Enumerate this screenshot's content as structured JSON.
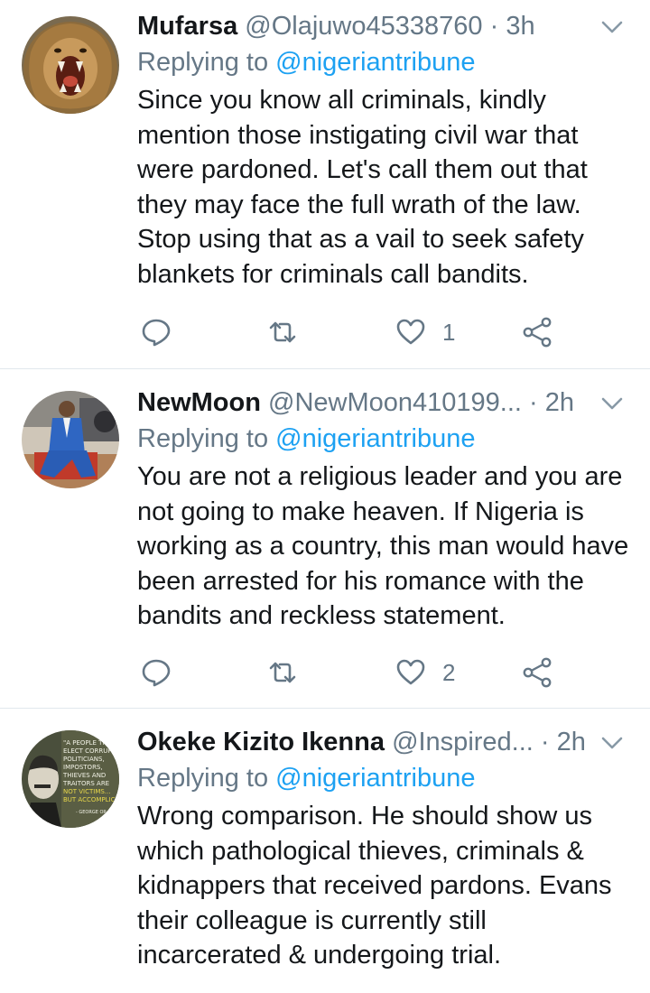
{
  "tweets": [
    {
      "name": "Mufarsa",
      "handle": "@Olajuwo45338760",
      "dot": "·",
      "time": "3h",
      "replying_prefix": "Replying to",
      "replying_to": "@nigeriantribune",
      "text": "Since you know all criminals, kindly mention those instigating civil war that were pardoned. Let's call them out that they may face the full wrath of the law. Stop using that as a vail to seek safety blankets for criminals call bandits.",
      "reply_count": "",
      "retweet_count": "",
      "like_count": "1",
      "avatar_icon": "lion-avatar"
    },
    {
      "name": "NewMoon",
      "handle": "@NewMoon410199...",
      "dot": "·",
      "time": "2h",
      "replying_prefix": "Replying to",
      "replying_to": "@nigeriantribune",
      "text": "You are not a religious leader and you are not going to make heaven. If Nigeria is working as a country, this man would have been arrested for his romance with the bandits and reckless statement.",
      "reply_count": "",
      "retweet_count": "",
      "like_count": "2",
      "avatar_icon": "man-in-blue-suit-avatar"
    },
    {
      "name": "Okeke Kizito Ikenna",
      "handle": "@Inspired...",
      "dot": "·",
      "time": "2h",
      "replying_prefix": "Replying to",
      "replying_to": "@nigeriantribune",
      "text": "Wrong comparison. He should show us which pathological thieves, criminals & kidnappers that received pardons. Evans their colleague is currently still incarcerated & undergoing trial.",
      "avatar_icon": "quote-poster-avatar",
      "avatar_quote": [
        "\"A PEOPLE THAT",
        "ELECT CORRUPT",
        "POLITICIANS,",
        "IMPOSTORS,",
        "THIEVES AND",
        "TRAITORS ARE",
        "NOT VICTIMS...",
        "BUT ACCOMPLICES\"",
        "- GEORGE OR"
      ]
    }
  ],
  "colors": {
    "text": "#14171a",
    "secondary": "#657786",
    "link": "#1da1f2",
    "divider": "#e1e8ed"
  }
}
